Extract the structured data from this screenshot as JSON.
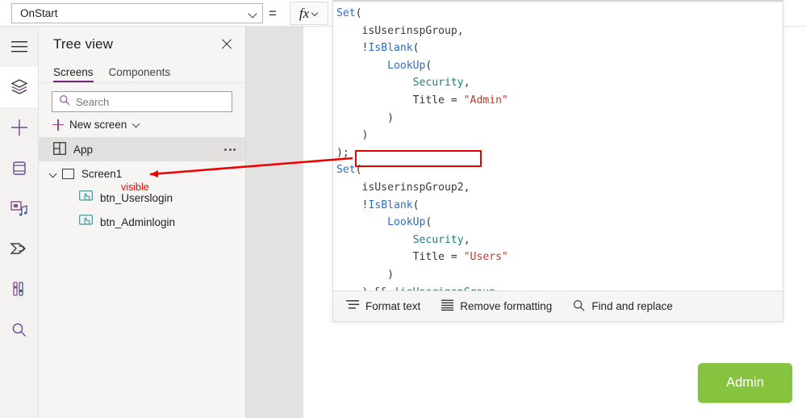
{
  "topbar": {
    "property_selector": {
      "value": "OnStart",
      "icon": "chevron-down-icon"
    },
    "equals_sign": "=",
    "fx_button": {
      "label": "fx",
      "icon": "chevron-down-icon"
    }
  },
  "rail": {
    "items": [
      {
        "name": "hamburger-menu-icon",
        "label": "Menu"
      },
      {
        "name": "tree-view-layers-icon",
        "label": "Tree view",
        "selected": true
      },
      {
        "name": "insert-plus-icon",
        "label": "Insert"
      },
      {
        "name": "data-cylinder-icon",
        "label": "Data"
      },
      {
        "name": "media-icon",
        "label": "Media"
      },
      {
        "name": "power-automate-icon",
        "label": "Power Automate"
      },
      {
        "name": "variables-icon",
        "label": "Variables"
      },
      {
        "name": "search-icon",
        "label": "Search"
      }
    ]
  },
  "treeview": {
    "title": "Tree view",
    "close_icon": "close-icon",
    "tabs": [
      {
        "label": "Screens",
        "active": true
      },
      {
        "label": "Components",
        "active": false
      }
    ],
    "search": {
      "placeholder": "Search",
      "value": "",
      "icon": "search-icon"
    },
    "new_screen": {
      "label": "New screen",
      "plus_icon": "plus-icon",
      "chevron_icon": "chevron-down-icon"
    },
    "tree": [
      {
        "label": "App",
        "icon": "app-grid-icon",
        "selected": true,
        "overflow": "ellipsis-icon",
        "level": 0
      },
      {
        "label": "Screen1",
        "icon": "screen-rect-icon",
        "expanded": true,
        "level": 0
      },
      {
        "label": "btn_Userslogin",
        "icon": "button-control-icon",
        "level": 1
      },
      {
        "label": "btn_Adminlogin",
        "icon": "button-control-icon",
        "level": 1
      }
    ]
  },
  "canvas": {
    "admin_button": {
      "label": "Admin",
      "color": "#86c440",
      "text_color": "#ffffff"
    }
  },
  "formula": {
    "lines": [
      [
        {
          "t": "Set",
          "c": "fn"
        },
        {
          "t": "(",
          "c": "plain"
        }
      ],
      [
        {
          "t": "    isUserinspGroup,",
          "c": "var"
        }
      ],
      [
        {
          "t": "    ",
          "c": "plain"
        },
        {
          "t": "!",
          "c": "plain"
        },
        {
          "t": "IsBlank",
          "c": "fn"
        },
        {
          "t": "(",
          "c": "plain"
        }
      ],
      [
        {
          "t": "        ",
          "c": "plain"
        },
        {
          "t": "LookUp",
          "c": "fn"
        },
        {
          "t": "(",
          "c": "plain"
        }
      ],
      [
        {
          "t": "            ",
          "c": "plain"
        },
        {
          "t": "Security",
          "c": "tbl"
        },
        {
          "t": ",",
          "c": "plain"
        }
      ],
      [
        {
          "t": "            Title = ",
          "c": "plain"
        },
        {
          "t": "\"Admin\"",
          "c": "str"
        }
      ],
      [
        {
          "t": "        )",
          "c": "plain"
        }
      ],
      [
        {
          "t": "    )",
          "c": "plain"
        }
      ],
      [
        {
          "t": ");",
          "c": "plain"
        }
      ],
      [
        {
          "t": "Set",
          "c": "fn"
        },
        {
          "t": "(",
          "c": "plain"
        }
      ],
      [
        {
          "t": "    isUserinspGroup2,",
          "c": "var"
        }
      ],
      [
        {
          "t": "    ",
          "c": "plain"
        },
        {
          "t": "!",
          "c": "plain"
        },
        {
          "t": "IsBlank",
          "c": "fn"
        },
        {
          "t": "(",
          "c": "plain"
        }
      ],
      [
        {
          "t": "        ",
          "c": "plain"
        },
        {
          "t": "LookUp",
          "c": "fn"
        },
        {
          "t": "(",
          "c": "plain"
        }
      ],
      [
        {
          "t": "            ",
          "c": "plain"
        },
        {
          "t": "Security",
          "c": "tbl"
        },
        {
          "t": ",",
          "c": "plain"
        }
      ],
      [
        {
          "t": "            Title = ",
          "c": "plain"
        },
        {
          "t": "\"Users\"",
          "c": "str"
        }
      ],
      [
        {
          "t": "        )",
          "c": "plain"
        }
      ],
      [
        {
          "t": "    ) && ",
          "c": "plain"
        },
        {
          "t": "!isUserinspGroup",
          "c": "tbl"
        }
      ],
      [
        {
          "t": ")",
          "c": "plain"
        }
      ]
    ],
    "toolbar": [
      {
        "label": "Format text",
        "icon": "format-text-icon"
      },
      {
        "label": "Remove formatting",
        "icon": "remove-formatting-icon"
      },
      {
        "label": "Find and replace",
        "icon": "search-icon"
      }
    ]
  },
  "annotations": {
    "label": "visible",
    "color": "#ff0000",
    "highlight_target": "isUserinspGroup2,"
  }
}
